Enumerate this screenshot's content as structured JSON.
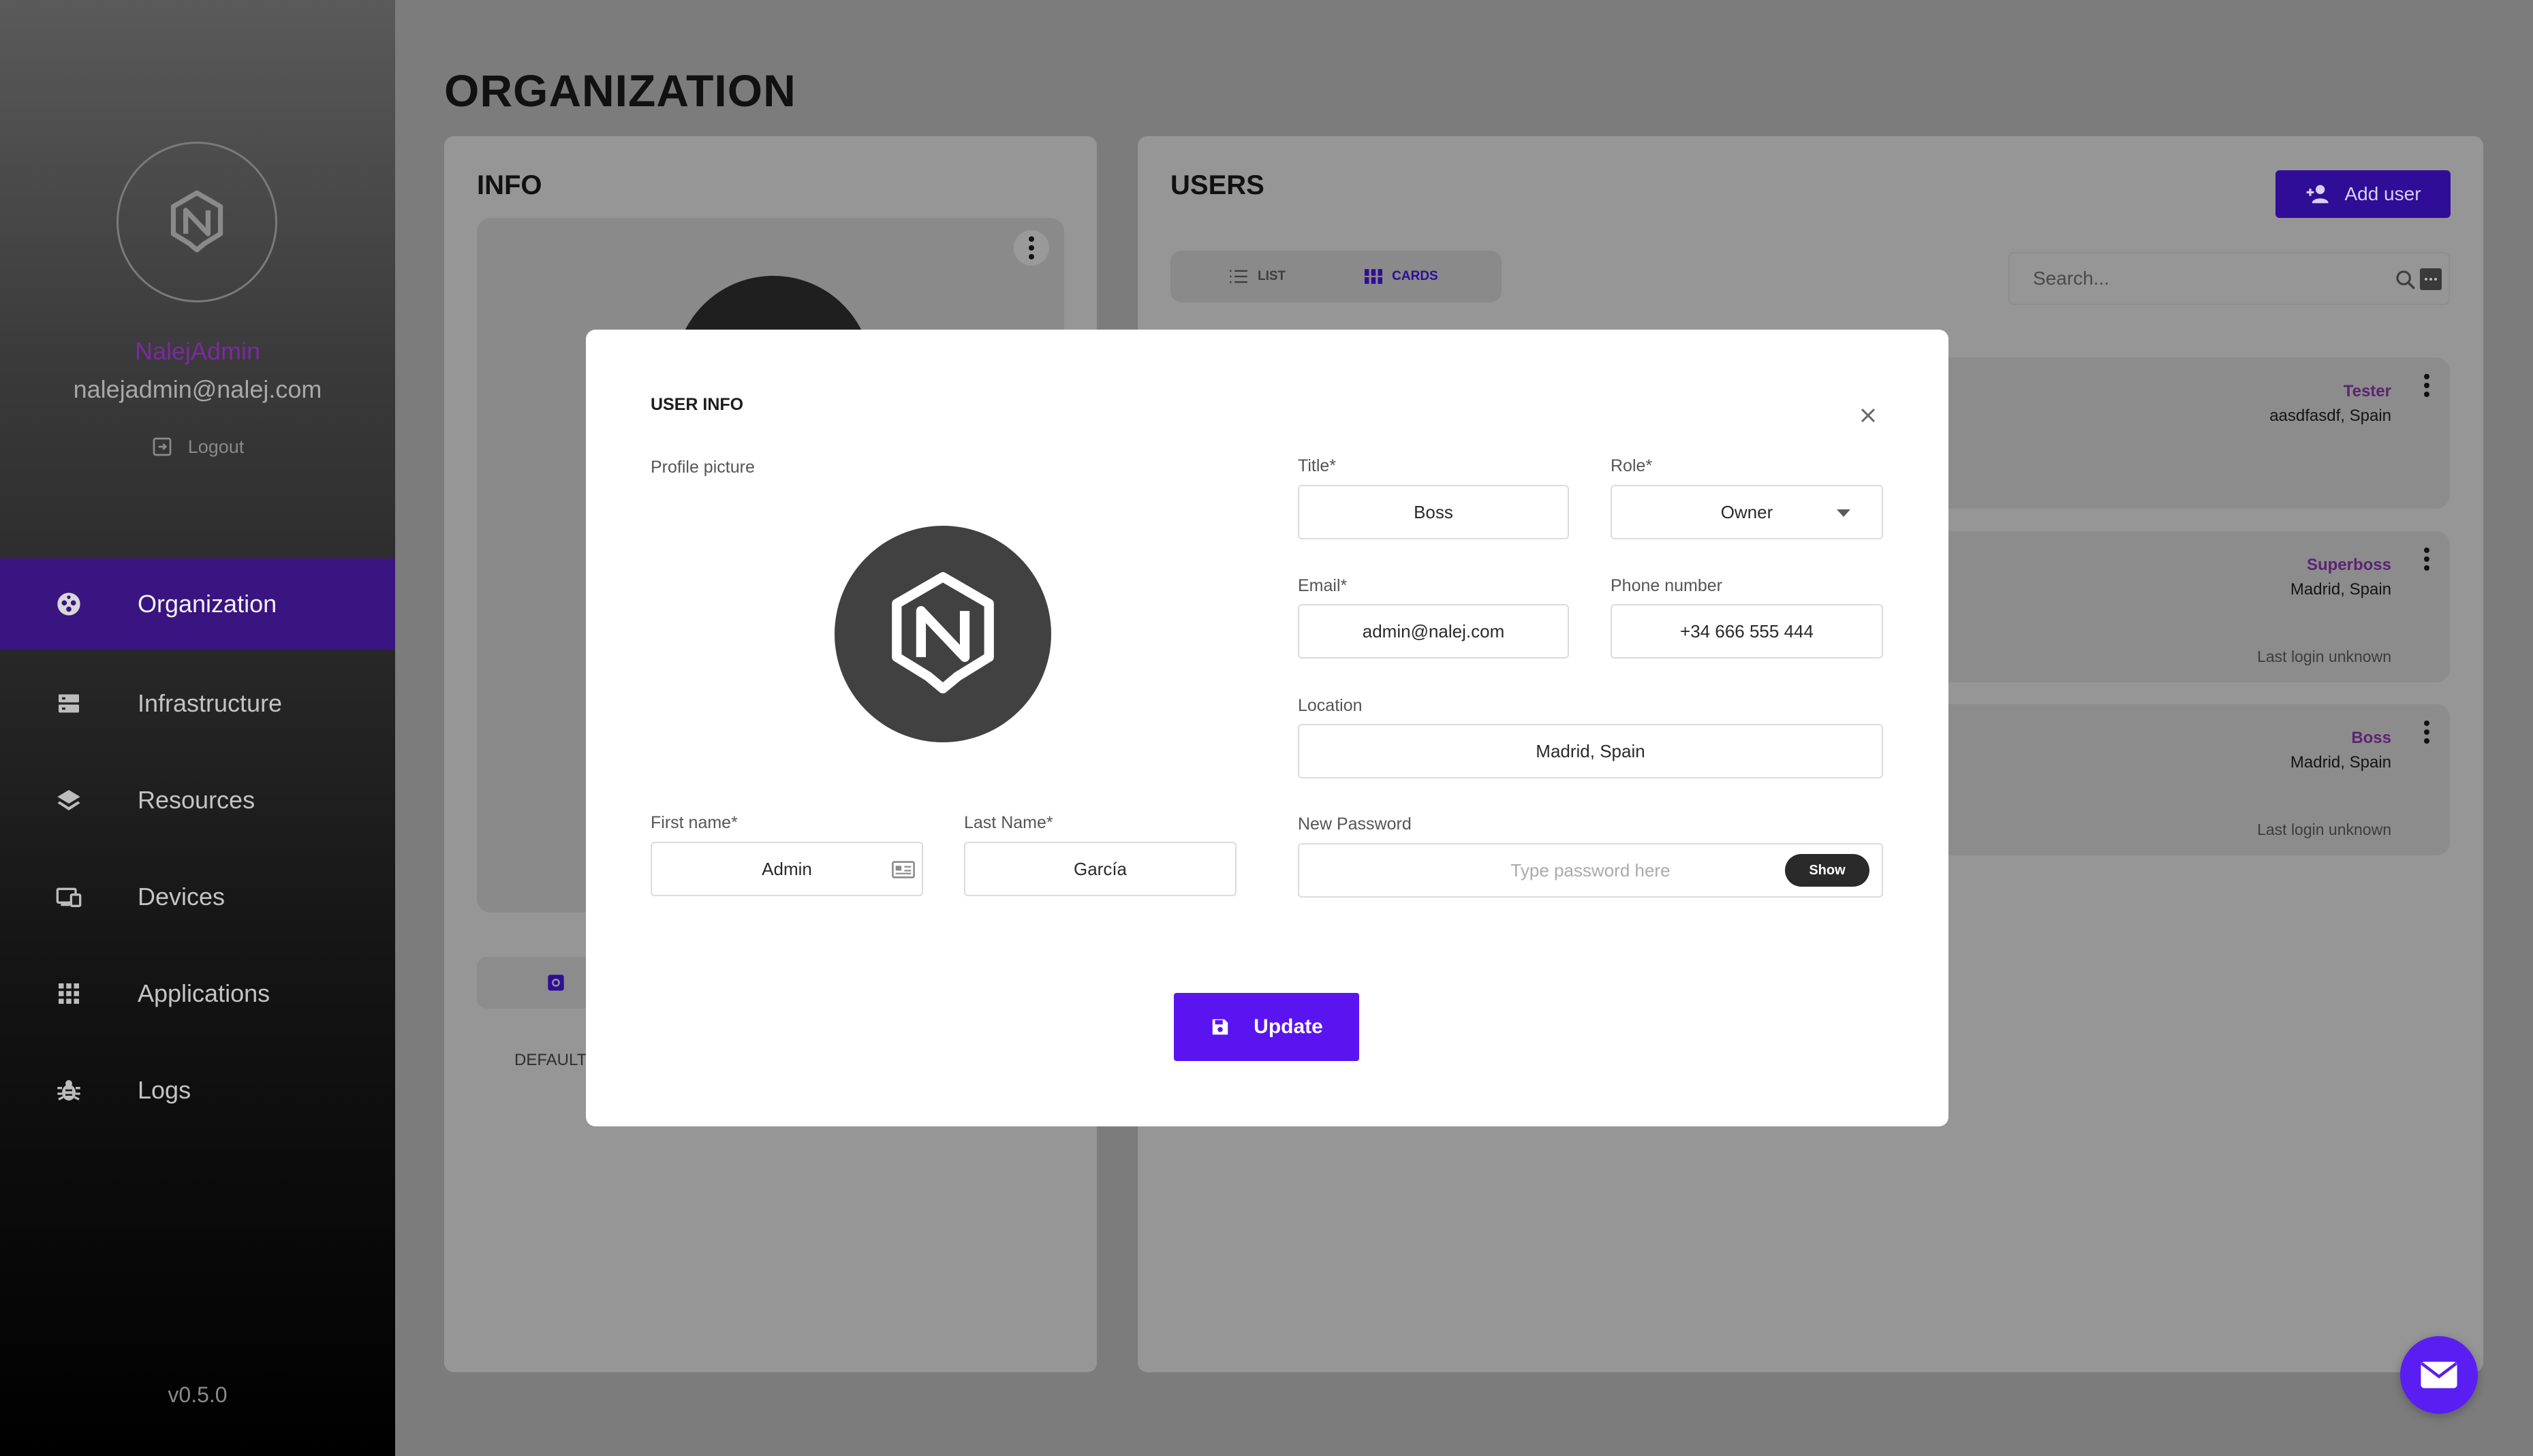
{
  "sidebar": {
    "user_name": "NalejAdmin",
    "user_email": "nalejadmin@nalej.com",
    "logout_label": "Logout",
    "items": [
      {
        "label": "Organization",
        "icon": "organization-icon",
        "active": true
      },
      {
        "label": "Infrastructure",
        "icon": "server-icon"
      },
      {
        "label": "Resources",
        "icon": "layers-icon"
      },
      {
        "label": "Devices",
        "icon": "devices-icon"
      },
      {
        "label": "Applications",
        "icon": "apps-grid-icon"
      },
      {
        "label": "Logs",
        "icon": "bug-icon"
      }
    ],
    "version": "v0.5.0"
  },
  "page": {
    "title": "ORGANIZATION",
    "info_panel": {
      "title": "INFO",
      "default_label": "DEFAULT"
    },
    "users_panel": {
      "title": "USERS",
      "add_user_label": "Add user",
      "view_toggle": {
        "list_label": "LIST",
        "cards_label": "CARDS",
        "selected": "CARDS"
      },
      "search_placeholder": "Search...",
      "cards": [
        {
          "role": "Tester",
          "location": "aasdfasdf, Spain",
          "last_login": ""
        },
        {
          "role": "Superboss",
          "location": "Madrid, Spain",
          "last_login": "Last login unknown"
        },
        {
          "role": "Boss",
          "location": "Madrid, Spain",
          "last_login": "Last login unknown"
        }
      ]
    }
  },
  "modal": {
    "title": "USER INFO",
    "profile_picture_label": "Profile picture",
    "first_name": {
      "label": "First name*",
      "value": "Admin"
    },
    "last_name": {
      "label": "Last Name*",
      "value": "García"
    },
    "title_field": {
      "label": "Title*",
      "value": "Boss"
    },
    "role": {
      "label": "Role*",
      "value": "Owner"
    },
    "email": {
      "label": "Email*",
      "value": "admin@nalej.com"
    },
    "phone": {
      "label": "Phone number",
      "value": "+34 666 555 444"
    },
    "location": {
      "label": "Location",
      "value": "Madrid, Spain"
    },
    "new_password": {
      "label": "New Password",
      "placeholder": "Type password here",
      "show_label": "Show"
    },
    "update_label": "Update"
  },
  "colors": {
    "accent": "#5a14f0",
    "sidebar_active": "#3a1480",
    "role_text": "#5c2374",
    "overlay": "#7c7c7c"
  }
}
